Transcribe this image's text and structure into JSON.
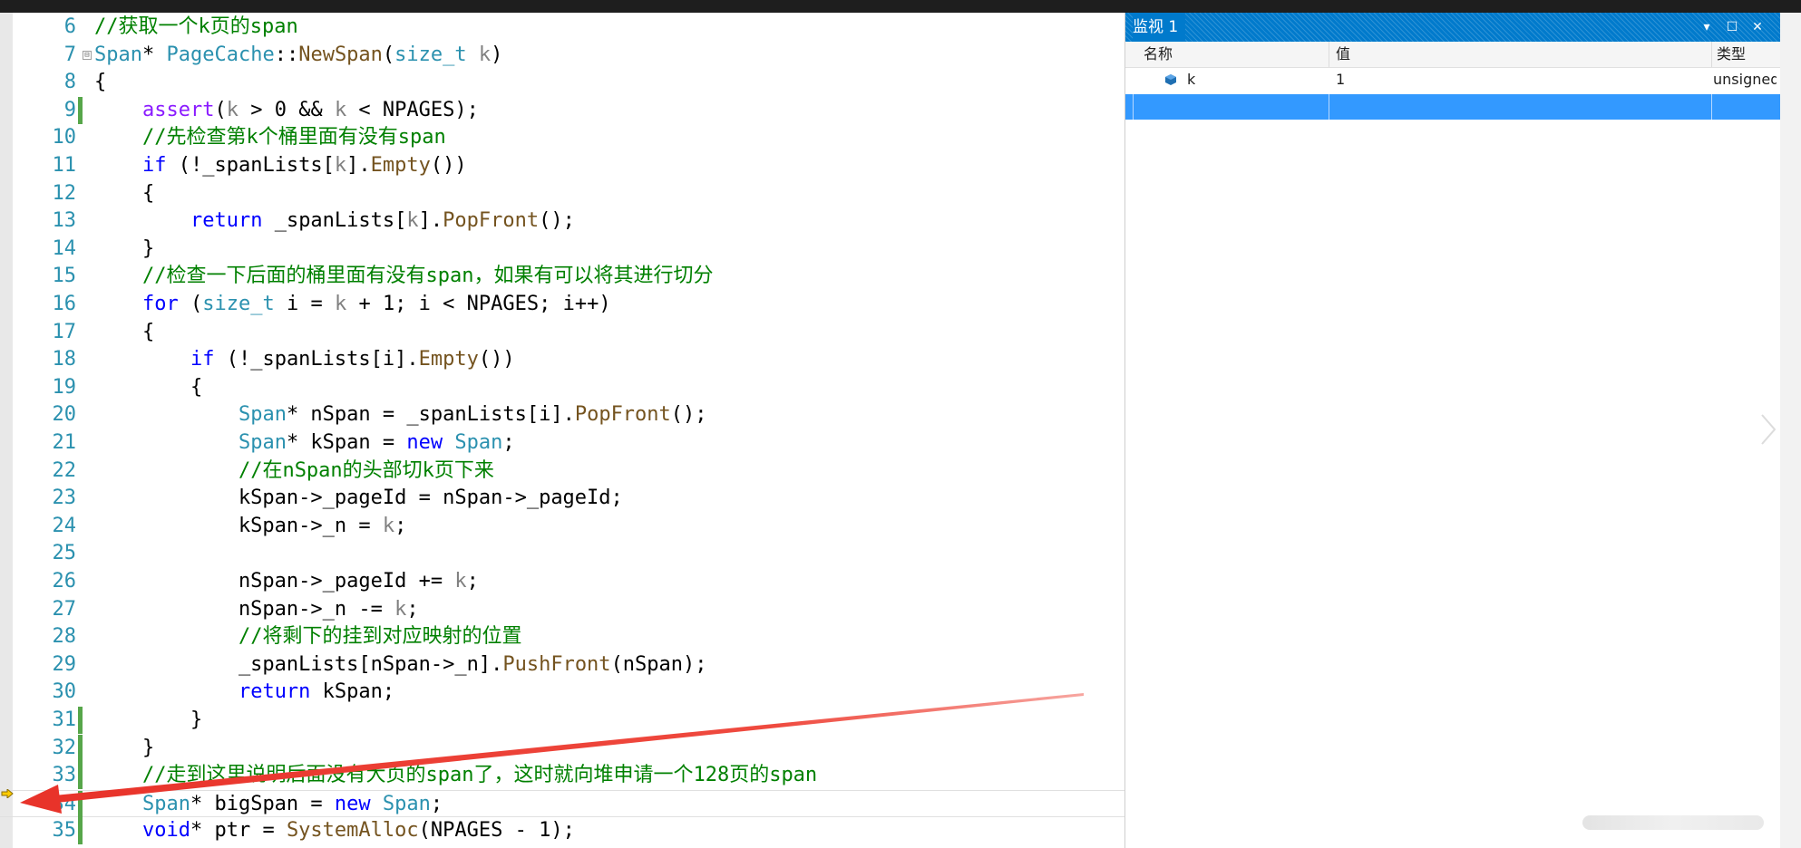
{
  "editor": {
    "lines": [
      {
        "num": "6",
        "changed": false,
        "tokens": [
          {
            "t": "cm",
            "v": "//获取一个k页的span"
          }
        ]
      },
      {
        "num": "7",
        "changed": false,
        "fold": "⊟",
        "tokens": [
          {
            "t": "type",
            "v": "Span"
          },
          {
            "t": "pl",
            "v": "* "
          },
          {
            "t": "type",
            "v": "PageCache"
          },
          {
            "t": "pl",
            "v": "::"
          },
          {
            "t": "fn",
            "v": "NewSpan"
          },
          {
            "t": "pl",
            "v": "("
          },
          {
            "t": "type",
            "v": "size_t"
          },
          {
            "t": "pl",
            "v": " "
          },
          {
            "t": "par",
            "v": "k"
          },
          {
            "t": "pl",
            "v": ")"
          }
        ]
      },
      {
        "num": "8",
        "changed": false,
        "tokens": [
          {
            "t": "pl",
            "v": "{"
          }
        ]
      },
      {
        "num": "9",
        "changed": true,
        "tokens": [
          {
            "t": "pl",
            "v": "    "
          },
          {
            "t": "mac",
            "v": "assert"
          },
          {
            "t": "pl",
            "v": "("
          },
          {
            "t": "par",
            "v": "k"
          },
          {
            "t": "pl",
            "v": " > 0 && "
          },
          {
            "t": "par",
            "v": "k"
          },
          {
            "t": "pl",
            "v": " < NPAGES);"
          }
        ]
      },
      {
        "num": "10",
        "changed": false,
        "tokens": [
          {
            "t": "pl",
            "v": "    "
          },
          {
            "t": "cm",
            "v": "//先检查第k个桶里面有没有span"
          }
        ]
      },
      {
        "num": "11",
        "changed": false,
        "tokens": [
          {
            "t": "pl",
            "v": "    "
          },
          {
            "t": "kw",
            "v": "if"
          },
          {
            "t": "pl",
            "v": " (!_spanLists["
          },
          {
            "t": "par",
            "v": "k"
          },
          {
            "t": "pl",
            "v": "]."
          },
          {
            "t": "fn",
            "v": "Empty"
          },
          {
            "t": "pl",
            "v": "())"
          }
        ]
      },
      {
        "num": "12",
        "changed": false,
        "tokens": [
          {
            "t": "pl",
            "v": "    {"
          }
        ]
      },
      {
        "num": "13",
        "changed": false,
        "tokens": [
          {
            "t": "pl",
            "v": "        "
          },
          {
            "t": "kw",
            "v": "return"
          },
          {
            "t": "pl",
            "v": " _spanLists["
          },
          {
            "t": "par",
            "v": "k"
          },
          {
            "t": "pl",
            "v": "]."
          },
          {
            "t": "fn",
            "v": "PopFront"
          },
          {
            "t": "pl",
            "v": "();"
          }
        ]
      },
      {
        "num": "14",
        "changed": false,
        "tokens": [
          {
            "t": "pl",
            "v": "    }"
          }
        ]
      },
      {
        "num": "15",
        "changed": false,
        "tokens": [
          {
            "t": "pl",
            "v": "    "
          },
          {
            "t": "cm",
            "v": "//检查一下后面的桶里面有没有span，如果有可以将其进行切分"
          }
        ]
      },
      {
        "num": "16",
        "changed": false,
        "tokens": [
          {
            "t": "pl",
            "v": "    "
          },
          {
            "t": "kw",
            "v": "for"
          },
          {
            "t": "pl",
            "v": " ("
          },
          {
            "t": "type",
            "v": "size_t"
          },
          {
            "t": "pl",
            "v": " i = "
          },
          {
            "t": "par",
            "v": "k"
          },
          {
            "t": "pl",
            "v": " + 1; i < NPAGES; i++)"
          }
        ]
      },
      {
        "num": "17",
        "changed": false,
        "tokens": [
          {
            "t": "pl",
            "v": "    {"
          }
        ]
      },
      {
        "num": "18",
        "changed": false,
        "tokens": [
          {
            "t": "pl",
            "v": "        "
          },
          {
            "t": "kw",
            "v": "if"
          },
          {
            "t": "pl",
            "v": " (!_spanLists[i]."
          },
          {
            "t": "fn",
            "v": "Empty"
          },
          {
            "t": "pl",
            "v": "())"
          }
        ]
      },
      {
        "num": "19",
        "changed": false,
        "tokens": [
          {
            "t": "pl",
            "v": "        {"
          }
        ]
      },
      {
        "num": "20",
        "changed": false,
        "tokens": [
          {
            "t": "pl",
            "v": "            "
          },
          {
            "t": "type",
            "v": "Span"
          },
          {
            "t": "pl",
            "v": "* nSpan = _spanLists[i]."
          },
          {
            "t": "fn",
            "v": "PopFront"
          },
          {
            "t": "pl",
            "v": "();"
          }
        ]
      },
      {
        "num": "21",
        "changed": false,
        "tokens": [
          {
            "t": "pl",
            "v": "            "
          },
          {
            "t": "type",
            "v": "Span"
          },
          {
            "t": "pl",
            "v": "* kSpan = "
          },
          {
            "t": "kw",
            "v": "new"
          },
          {
            "t": "pl",
            "v": " "
          },
          {
            "t": "type",
            "v": "Span"
          },
          {
            "t": "pl",
            "v": ";"
          }
        ]
      },
      {
        "num": "22",
        "changed": false,
        "tokens": [
          {
            "t": "pl",
            "v": "            "
          },
          {
            "t": "cm",
            "v": "//在nSpan的头部切k页下来"
          }
        ]
      },
      {
        "num": "23",
        "changed": false,
        "tokens": [
          {
            "t": "pl",
            "v": "            kSpan->_pageId = nSpan->_pageId;"
          }
        ]
      },
      {
        "num": "24",
        "changed": false,
        "tokens": [
          {
            "t": "pl",
            "v": "            kSpan->_n = "
          },
          {
            "t": "par",
            "v": "k"
          },
          {
            "t": "pl",
            "v": ";"
          }
        ]
      },
      {
        "num": "25",
        "changed": false,
        "tokens": [
          {
            "t": "pl",
            "v": ""
          }
        ]
      },
      {
        "num": "26",
        "changed": false,
        "tokens": [
          {
            "t": "pl",
            "v": "            nSpan->_pageId += "
          },
          {
            "t": "par",
            "v": "k"
          },
          {
            "t": "pl",
            "v": ";"
          }
        ]
      },
      {
        "num": "27",
        "changed": false,
        "tokens": [
          {
            "t": "pl",
            "v": "            nSpan->_n -= "
          },
          {
            "t": "par",
            "v": "k"
          },
          {
            "t": "pl",
            "v": ";"
          }
        ]
      },
      {
        "num": "28",
        "changed": false,
        "tokens": [
          {
            "t": "pl",
            "v": "            "
          },
          {
            "t": "cm",
            "v": "//将剩下的挂到对应映射的位置"
          }
        ]
      },
      {
        "num": "29",
        "changed": false,
        "tokens": [
          {
            "t": "pl",
            "v": "            _spanLists[nSpan->_n]."
          },
          {
            "t": "fn",
            "v": "PushFront"
          },
          {
            "t": "pl",
            "v": "(nSpan);"
          }
        ]
      },
      {
        "num": "30",
        "changed": false,
        "tokens": [
          {
            "t": "pl",
            "v": "            "
          },
          {
            "t": "kw",
            "v": "return"
          },
          {
            "t": "pl",
            "v": " kSpan;"
          }
        ]
      },
      {
        "num": "31",
        "changed": true,
        "tokens": [
          {
            "t": "pl",
            "v": "        }"
          }
        ]
      },
      {
        "num": "32",
        "changed": true,
        "tokens": [
          {
            "t": "pl",
            "v": "    }"
          }
        ]
      },
      {
        "num": "33",
        "changed": true,
        "tokens": [
          {
            "t": "pl",
            "v": "    "
          },
          {
            "t": "cm",
            "v": "//走到这里说明后面没有大页的span了，这时就向堆申请一个128页的span"
          }
        ]
      },
      {
        "num": "34",
        "changed": true,
        "current": true,
        "tokens": [
          {
            "t": "pl",
            "v": "    "
          },
          {
            "t": "type",
            "v": "Span"
          },
          {
            "t": "pl",
            "v": "* bigSpan = "
          },
          {
            "t": "kw",
            "v": "new"
          },
          {
            "t": "pl",
            "v": " "
          },
          {
            "t": "type",
            "v": "Span"
          },
          {
            "t": "pl",
            "v": ";"
          }
        ]
      },
      {
        "num": "35",
        "changed": true,
        "tokens": [
          {
            "t": "pl",
            "v": "    "
          },
          {
            "t": "kw",
            "v": "void"
          },
          {
            "t": "pl",
            "v": "* ptr = "
          },
          {
            "t": "fn",
            "v": "SystemAlloc"
          },
          {
            "t": "pl",
            "v": "(NPAGES - 1);"
          }
        ]
      }
    ]
  },
  "watch": {
    "title": "监视 1",
    "controls": {
      "dropdown": "▾",
      "maximize": "☐",
      "close": "✕"
    },
    "columns": {
      "name": "名称",
      "value": "值",
      "type": "类型"
    },
    "rows": [
      {
        "name": "k",
        "value": "1",
        "type": "unsigned",
        "icon": "variable-icon"
      }
    ]
  },
  "colors": {
    "accent": "#007acc",
    "selection": "#3399ff",
    "keyword": "#0000ff",
    "type": "#2b91af",
    "comment": "#008000",
    "annotation_arrow": "#e8332a"
  }
}
